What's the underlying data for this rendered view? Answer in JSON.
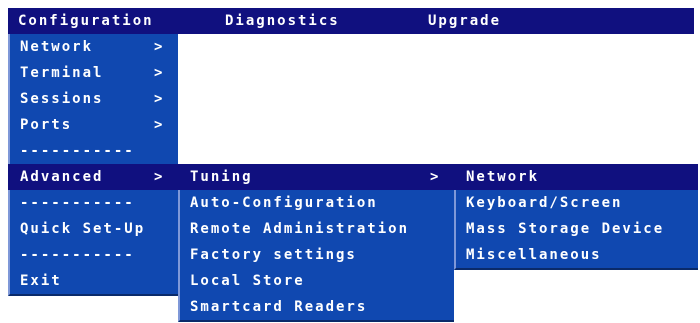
{
  "menubar": [
    "Configuration",
    "Diagnostics",
    "Upgrade"
  ],
  "main_menu": {
    "items": [
      "Network",
      "Terminal",
      "Sessions",
      "Ports",
      "Advanced",
      "Quick Set-Up",
      "Exit"
    ],
    "separator": "-----------",
    "arrow": ">"
  },
  "advanced_menu": {
    "items": [
      "Tuning",
      "Auto-Configuration",
      "Remote Administration",
      "Factory settings",
      "Local Store",
      "Smartcard Readers"
    ],
    "arrow": ">"
  },
  "tuning_menu": {
    "items": [
      "Network",
      "Keyboard/Screen",
      "Mass Storage Device",
      "Miscellaneous"
    ]
  },
  "colors": {
    "menubar": "#10107f",
    "panel": "#1048b0",
    "highlight": "#10107f",
    "text": "#ffffff"
  }
}
